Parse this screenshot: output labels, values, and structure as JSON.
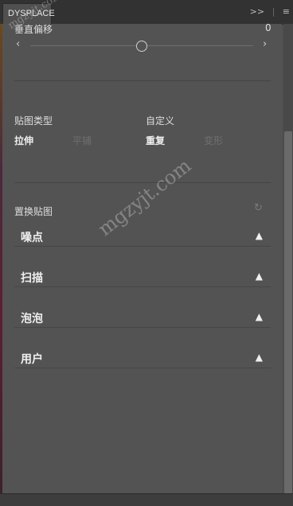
{
  "panel": {
    "tab_label": "DYSPLACE",
    "expand_icon": "double-chevron-right-icon",
    "menu_icon": "hamburger-menu-icon"
  },
  "vertical_offset": {
    "label": "垂直偏移",
    "value": "0",
    "left_arrow": "‹",
    "right_arrow": "›",
    "slider_level_fraction": 0.5
  },
  "map_type": {
    "label": "贴图类型",
    "options": [
      "拉伸",
      "平铺"
    ],
    "selected": "拉伸"
  },
  "custom": {
    "label": "自定义",
    "options": [
      "重复",
      "变形"
    ],
    "selected": "重复"
  },
  "replace_map": {
    "label": "置换贴图",
    "refresh_icon": "refresh-icon"
  },
  "sections": [
    {
      "title": "噪点"
    },
    {
      "title": "扫描"
    },
    {
      "title": "泡泡"
    },
    {
      "title": "用户"
    }
  ],
  "watermark": [
    "mgzyjt.com",
    "mgzyjt.com"
  ]
}
